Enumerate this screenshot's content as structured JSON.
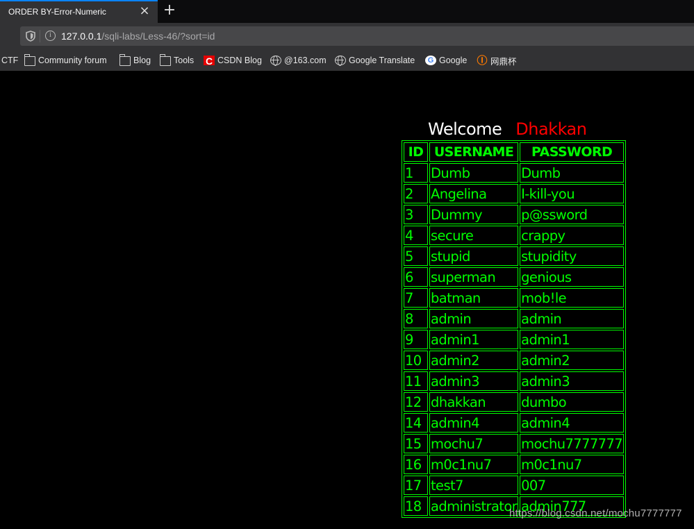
{
  "browser": {
    "tab": {
      "title": "ORDER BY-Error-Numeric",
      "close_icon": "×",
      "new_tab_icon": "+"
    },
    "urlbar": {
      "host": "127.0.0.1",
      "path": "/sqli-labs/Less-46/?sort=id"
    },
    "bookmarks": [
      {
        "label": "CTF",
        "icon": "none"
      },
      {
        "label": "Community forum",
        "icon": "folder-icon"
      },
      {
        "label": "Blog",
        "icon": "folder-icon"
      },
      {
        "label": "Tools",
        "icon": "folder-icon"
      },
      {
        "label": "CSDN Blog",
        "icon": "csdn-icon"
      },
      {
        "label": "@163.com",
        "icon": "globe-icon"
      },
      {
        "label": "Google Translate",
        "icon": "globe-icon"
      },
      {
        "label": "Google",
        "icon": "google-icon"
      },
      {
        "label": "网鼎杯",
        "icon": "wangding-icon"
      }
    ]
  },
  "page": {
    "welcome": "Welcome",
    "user_name": "Dhakkan",
    "colors": {
      "accent": "#00ff00",
      "name": "#ff0000",
      "background": "#000000"
    },
    "table": {
      "headers": [
        "ID",
        "USERNAME",
        "PASSWORD"
      ],
      "rows": [
        [
          "1",
          "Dumb",
          "Dumb"
        ],
        [
          "2",
          "Angelina",
          "I-kill-you"
        ],
        [
          "3",
          "Dummy",
          "p@ssword"
        ],
        [
          "4",
          "secure",
          "crappy"
        ],
        [
          "5",
          "stupid",
          "stupidity"
        ],
        [
          "6",
          "superman",
          "genious"
        ],
        [
          "7",
          "batman",
          "mob!le"
        ],
        [
          "8",
          "admin",
          "admin"
        ],
        [
          "9",
          "admin1",
          "admin1"
        ],
        [
          "10",
          "admin2",
          "admin2"
        ],
        [
          "11",
          "admin3",
          "admin3"
        ],
        [
          "12",
          "dhakkan",
          "dumbo"
        ],
        [
          "14",
          "admin4",
          "admin4"
        ],
        [
          "15",
          "mochu7",
          "mochu7777777"
        ],
        [
          "16",
          "m0c1nu7",
          "m0c1nu7"
        ],
        [
          "17",
          "test7",
          "007"
        ],
        [
          "18",
          "administrator",
          "admin777"
        ]
      ]
    }
  },
  "watermark": "https://blog.csdn.net/mochu7777777"
}
